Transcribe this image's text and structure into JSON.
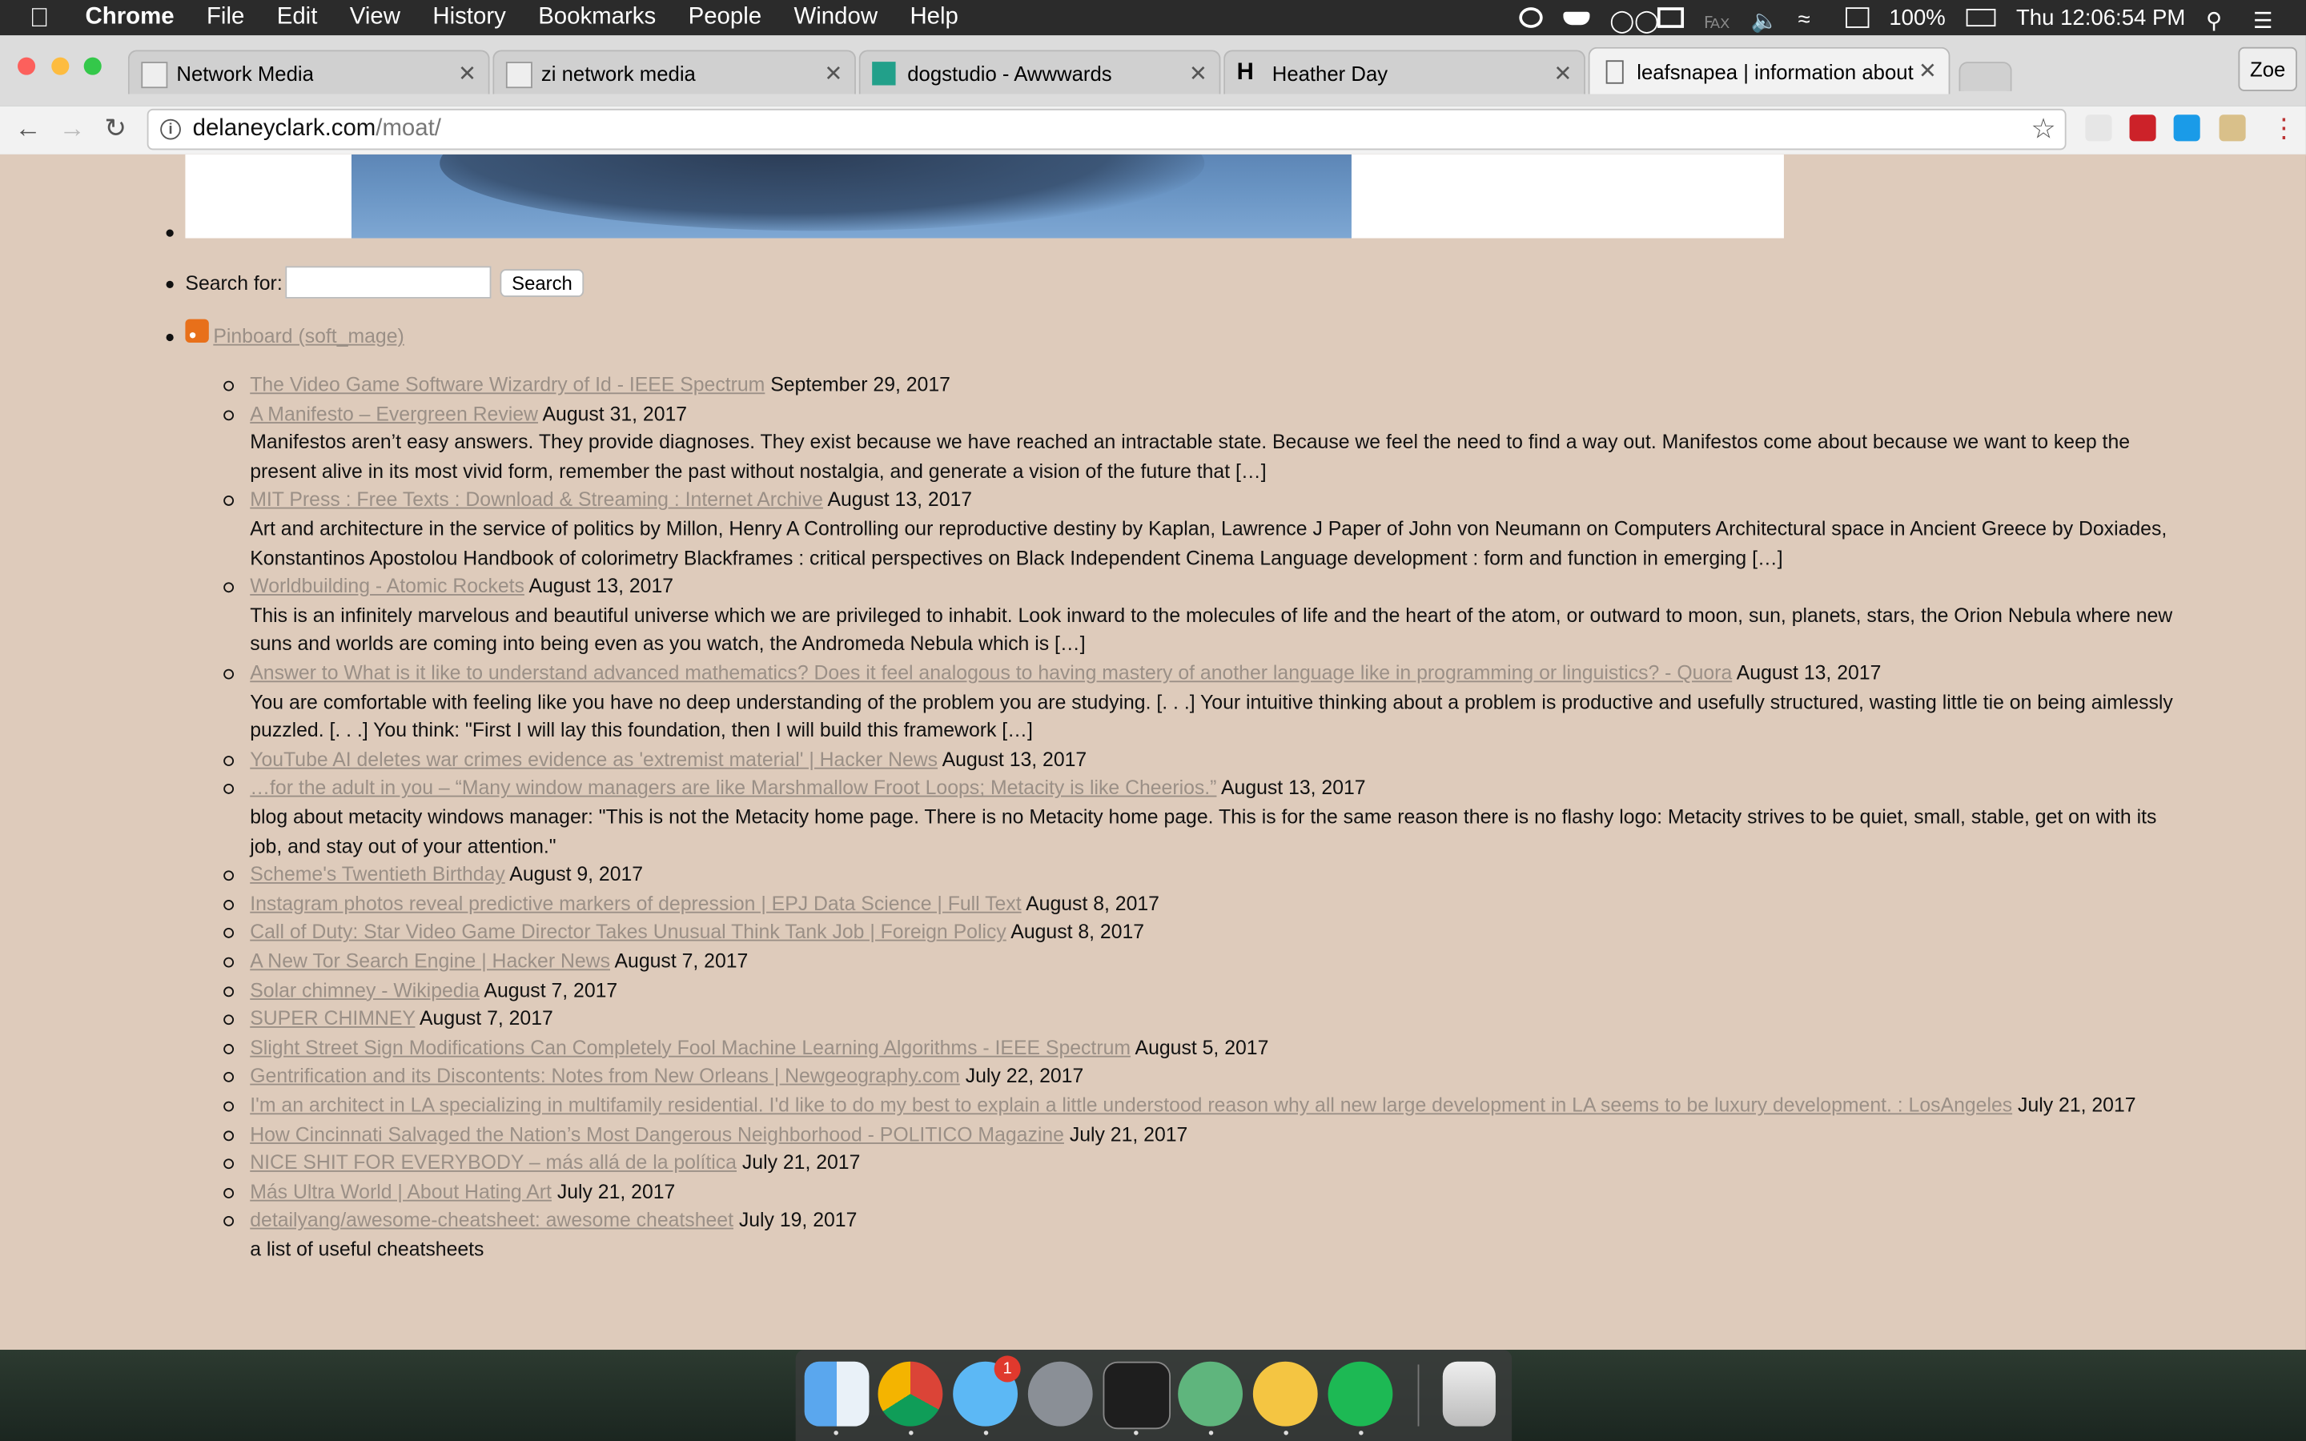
{
  "menubar": {
    "app": "Chrome",
    "items": [
      "File",
      "Edit",
      "View",
      "History",
      "Bookmarks",
      "People",
      "Window",
      "Help"
    ],
    "battery": "100%",
    "clock": "Thu 12:06:54 PM"
  },
  "tabs": [
    {
      "label": "Network Media",
      "active": false
    },
    {
      "label": "zi network media",
      "active": false
    },
    {
      "label": "dogstudio - Awwwards",
      "active": false
    },
    {
      "label": "Heather Day",
      "active": false
    },
    {
      "label": "leafsnapea | information about",
      "active": true
    }
  ],
  "profile": "Zoe",
  "address": {
    "domain": "delaneyclark.com",
    "path": "/moat/"
  },
  "sidebar": {
    "search_label": "Search for:",
    "search_button": "Search",
    "feed_title": "Pinboard (soft_mage)"
  },
  "feed": [
    {
      "title": "The Video Game Software Wizardry of Id - IEEE Spectrum",
      "date": "September 29, 2017",
      "desc": ""
    },
    {
      "title": "A Manifesto – Evergreen Review",
      "date": "August 31, 2017",
      "desc": "Manifestos aren’t easy answers. They provide diagnoses. They exist because we have reached an intractable state. Because we feel the need to find a way out. Manifestos come about because we want to keep the present alive in its most vivid form, remember the past without nostalgia, and generate a vision of the future that […]"
    },
    {
      "title": "MIT Press : Free Texts : Download & Streaming : Internet Archive",
      "date": "August 13, 2017",
      "desc": "Art and architecture in the service of politics by Millon, Henry A Controlling our reproductive destiny by Kaplan, Lawrence J Paper of John von Neumann on Computers Architectural space in Ancient Greece by Doxiades, Konstantinos Apostolou Handbook of colorimetry Blackframes : critical perspectives on Black Independent Cinema Language development : form and function in emerging […]"
    },
    {
      "title": "Worldbuilding - Atomic Rockets",
      "date": "August 13, 2017",
      "desc": "This is an infinitely marvelous and beautiful universe which we are privileged to inhabit. Look inward to the molecules of life and the heart of the atom, or outward to moon, sun, planets, stars, the Orion Nebula where new suns and worlds are coming into being even as you watch, the Andromeda Nebula which is […]"
    },
    {
      "title": "Answer to What is it like to understand advanced mathematics? Does it feel analogous to having mastery of another language like in programming or linguistics? - Quora",
      "date": "August 13, 2017",
      "desc": "You are comfortable with feeling like you have no deep understanding of the problem you are studying. [. . .] Your intuitive thinking about a problem is productive and usefully structured, wasting little tie on being aimlessly puzzled. [. . .] You think: \"First I will lay this foundation, then I will build this framework […]"
    },
    {
      "title": "YouTube AI deletes war crimes evidence as 'extremist material' | Hacker News",
      "date": "August 13, 2017",
      "desc": ""
    },
    {
      "title": "…for the adult in you – “Many window managers are like Marshmallow Froot Loops; Metacity is like Cheerios.”",
      "date": "August 13, 2017",
      "desc": "blog about metacity windows manager: \"This is not the Metacity home page. There is no Metacity home page. This is for the same reason there is no flashy logo: Metacity strives to be quiet, small, stable, get on with its job, and stay out of your attention.\""
    },
    {
      "title": "Scheme's Twentieth Birthday",
      "date": "August 9, 2017",
      "desc": ""
    },
    {
      "title": "Instagram photos reveal predictive markers of depression | EPJ Data Science | Full Text",
      "date": "August 8, 2017",
      "desc": ""
    },
    {
      "title": "Call of Duty: Star Video Game Director Takes Unusual Think Tank Job | Foreign Policy",
      "date": "August 8, 2017",
      "desc": ""
    },
    {
      "title": "A New Tor Search Engine | Hacker News",
      "date": "August 7, 2017",
      "desc": ""
    },
    {
      "title": "Solar chimney - Wikipedia",
      "date": "August 7, 2017",
      "desc": ""
    },
    {
      "title": "SUPER CHIMNEY",
      "date": "August 7, 2017",
      "desc": ""
    },
    {
      "title": "Slight Street Sign Modifications Can Completely Fool Machine Learning Algorithms - IEEE Spectrum",
      "date": "August 5, 2017",
      "desc": ""
    },
    {
      "title": "Gentrification and its Discontents: Notes from New Orleans | Newgeography.com",
      "date": "July 22, 2017",
      "desc": ""
    },
    {
      "title": "I'm an architect in LA specializing in multifamily residential. I'd like to do my best to explain a little understood reason why all new large development in LA seems to be luxury development. : LosAngeles",
      "date": "July 21, 2017",
      "desc": ""
    },
    {
      "title": "How Cincinnati Salvaged the Nation’s Most Dangerous Neighborhood - POLITICO Magazine",
      "date": "July 21, 2017",
      "desc": ""
    },
    {
      "title": "NICE SHIT FOR EVERYBODY – más allá de la política",
      "date": "July 21, 2017",
      "desc": ""
    },
    {
      "title": "Más Ultra World | About Hating Art",
      "date": "July 21, 2017",
      "desc": ""
    },
    {
      "title": "detailyang/awesome-cheatsheet: awesome cheatsheet",
      "date": "July 19, 2017",
      "desc": "a list of useful cheatsheets"
    }
  ],
  "dock": {
    "messages_badge": "1"
  }
}
